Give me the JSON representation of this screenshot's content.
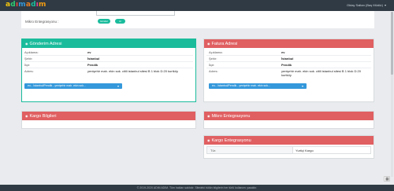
{
  "app": {
    "logo": "adım adım",
    "user": "Oktay Saltan (Baş Müdür)"
  },
  "top": {
    "mikro_label": "Mikro Entegrasyonu :",
    "btn_gonder": "Gönder",
    "btn_al": "Al"
  },
  "gonderim": {
    "title": "Gönderim Adresi",
    "labels": {
      "aciklama": "Açıklama:",
      "sehir": "Şehir:",
      "ilce": "İlçe:",
      "adres": "Adres:"
    },
    "values": {
      "aciklama": "ev",
      "sehir": "İstanbul",
      "ilce": "Pendik",
      "adres": "yenişehir mah. ekin sok. citili istanbul sitesi B 1 blok D:20 kurtköy"
    },
    "select": "ev... İstanbul/Pendik - yenişehir mah. ekin sok..."
  },
  "fatura": {
    "title": "Fatura Adresi",
    "labels": {
      "aciklama": "Açıklama:",
      "sehir": "Şehir:",
      "ilce": "İlçe:",
      "adres": "Adres:"
    },
    "values": {
      "aciklama": "ev",
      "sehir": "İstanbul",
      "ilce": "Pendik",
      "adres": "yenişehir mah. ekin sok. citili istanbul sitesi B 1 blok D:20 kurtköy"
    },
    "select": "ev... İstanbul/Pendik - yenişehir mah. ekin sok..."
  },
  "kargo_bilgileri": {
    "title": "Kargo Bilgileri"
  },
  "mikro_entegrasyonu": {
    "title": "Mikro Entegrasyonu"
  },
  "kargo_entegrasyonu": {
    "title": "Kargo Entegrasyonu",
    "row_label": "Tür:",
    "row_value": "Yurtiçi Kargo"
  },
  "footer": {
    "text": "© 2019-2020 ADIM ADIM. Tüm hakları saklıdır. Sitedeki bütün bilgilerin her türlü kullanımı yasaktır."
  },
  "colors": {
    "teal": "#1abc9c",
    "red": "#e05f61",
    "blue": "#3498db",
    "navbar": "#2f3a44"
  },
  "icons": {
    "panel": "glyph-icon",
    "select": "chevron-down-icon",
    "corner": "grid-icon"
  }
}
